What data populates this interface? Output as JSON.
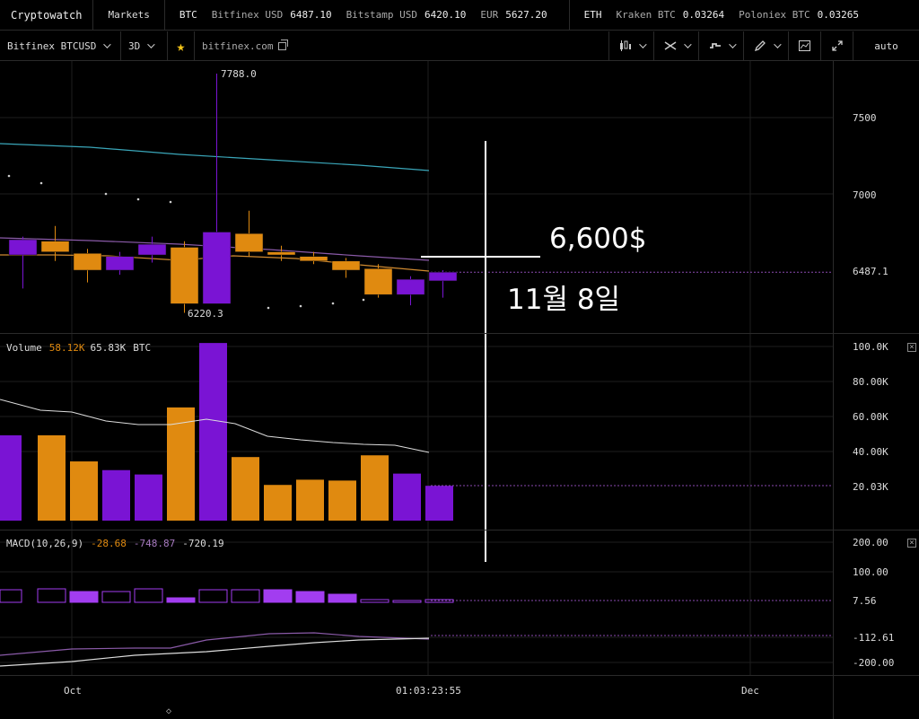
{
  "topbar": {
    "brand": "Cryptowatch",
    "markets": "Markets",
    "groups": [
      {
        "coin": "BTC",
        "items": [
          {
            "exchange": "Bitfinex USD",
            "price": "6487.10"
          },
          {
            "exchange": "Bitstamp USD",
            "price": "6420.10"
          },
          {
            "exchange": "EUR",
            "price": "5627.20"
          }
        ]
      },
      {
        "coin": "ETH",
        "items": [
          {
            "exchange": "Kraken BTC",
            "price": "0.03264"
          },
          {
            "exchange": "Poloniex BTC",
            "price": "0.03265"
          }
        ]
      }
    ]
  },
  "toolbar": {
    "market": "Bitfinex BTCUSD",
    "period": "3D",
    "link": "bitfinex.com",
    "zoom": "auto",
    "icons": [
      "candles-icon",
      "crosshair-icon",
      "line-style-icon",
      "pencil-icon",
      "chart-icon",
      "expand-icon"
    ]
  },
  "price_panel": {
    "high_label": "7788.0",
    "low_label": "6220.3",
    "last_price": "6487.1",
    "y_ticks": [
      "7500",
      "7000"
    ]
  },
  "volume_panel": {
    "label": "Volume",
    "value1": "58.12K",
    "value2": "65.83K",
    "unit": "BTC",
    "y_ticks": [
      "100.0K",
      "80.00K",
      "60.00K",
      "40.00K",
      "20.03K"
    ]
  },
  "macd_panel": {
    "label": "MACD(10,26,9)",
    "v1": "-28.68",
    "v2": "-748.87",
    "v3": "-720.19",
    "y_ticks": [
      "200.00",
      "100.00",
      "7.56",
      "-112.61",
      "-200.00"
    ]
  },
  "x_axis": {
    "oct": "Oct",
    "time": "01:03:23:55",
    "dec": "Dec"
  },
  "annotations": {
    "price_note": "6,600$",
    "date_note": "11월 8일"
  },
  "colors": {
    "up": "#e08a10",
    "down": "#7a14d4",
    "macd_hist": "#a23df0",
    "ma_long": "#3aa6b9",
    "ma_short": "#d08a30",
    "ma_purple": "#8a5aa8"
  },
  "chart_data": {
    "type": "candlestick",
    "candles": [
      {
        "o": 6700,
        "c": 6600,
        "h": 6720,
        "l": 6380,
        "dir": "down"
      },
      {
        "o": 6620,
        "c": 6690,
        "h": 6790,
        "l": 6560,
        "dir": "up"
      },
      {
        "o": 6610,
        "c": 6500,
        "h": 6640,
        "l": 6420,
        "dir": "up"
      },
      {
        "o": 6590,
        "c": 6500,
        "h": 6620,
        "l": 6470,
        "dir": "down"
      },
      {
        "o": 6600,
        "c": 6670,
        "h": 6720,
        "l": 6550,
        "dir": "down"
      },
      {
        "o": 6650,
        "c": 6280,
        "h": 6690,
        "l": 6220.3,
        "dir": "up"
      },
      {
        "o": 6280,
        "c": 6750,
        "h": 7788,
        "l": 6280,
        "dir": "down"
      },
      {
        "o": 6740,
        "c": 6620,
        "h": 6890,
        "l": 6590,
        "dir": "up"
      },
      {
        "o": 6620,
        "c": 6600,
        "h": 6660,
        "l": 6560,
        "dir": "up"
      },
      {
        "o": 6590,
        "c": 6560,
        "h": 6620,
        "l": 6540,
        "dir": "up"
      },
      {
        "o": 6560,
        "c": 6500,
        "h": 6580,
        "l": 6450,
        "dir": "up"
      },
      {
        "o": 6510,
        "c": 6340,
        "h": 6540,
        "l": 6320,
        "dir": "up"
      },
      {
        "o": 6440,
        "c": 6340,
        "h": 6460,
        "l": 6270,
        "dir": "down"
      },
      {
        "o": 6430,
        "c": 6487.1,
        "h": 6500,
        "l": 6320,
        "dir": "down"
      }
    ],
    "volume": [
      49000,
      49000,
      34000,
      29000,
      26500,
      65000,
      102000,
      36500,
      20500,
      23500,
      23000,
      37500,
      27000,
      20000
    ],
    "macd_hist": [
      14,
      15,
      12,
      12,
      15,
      5,
      14,
      14,
      14,
      12,
      9,
      3,
      2,
      3
    ]
  }
}
